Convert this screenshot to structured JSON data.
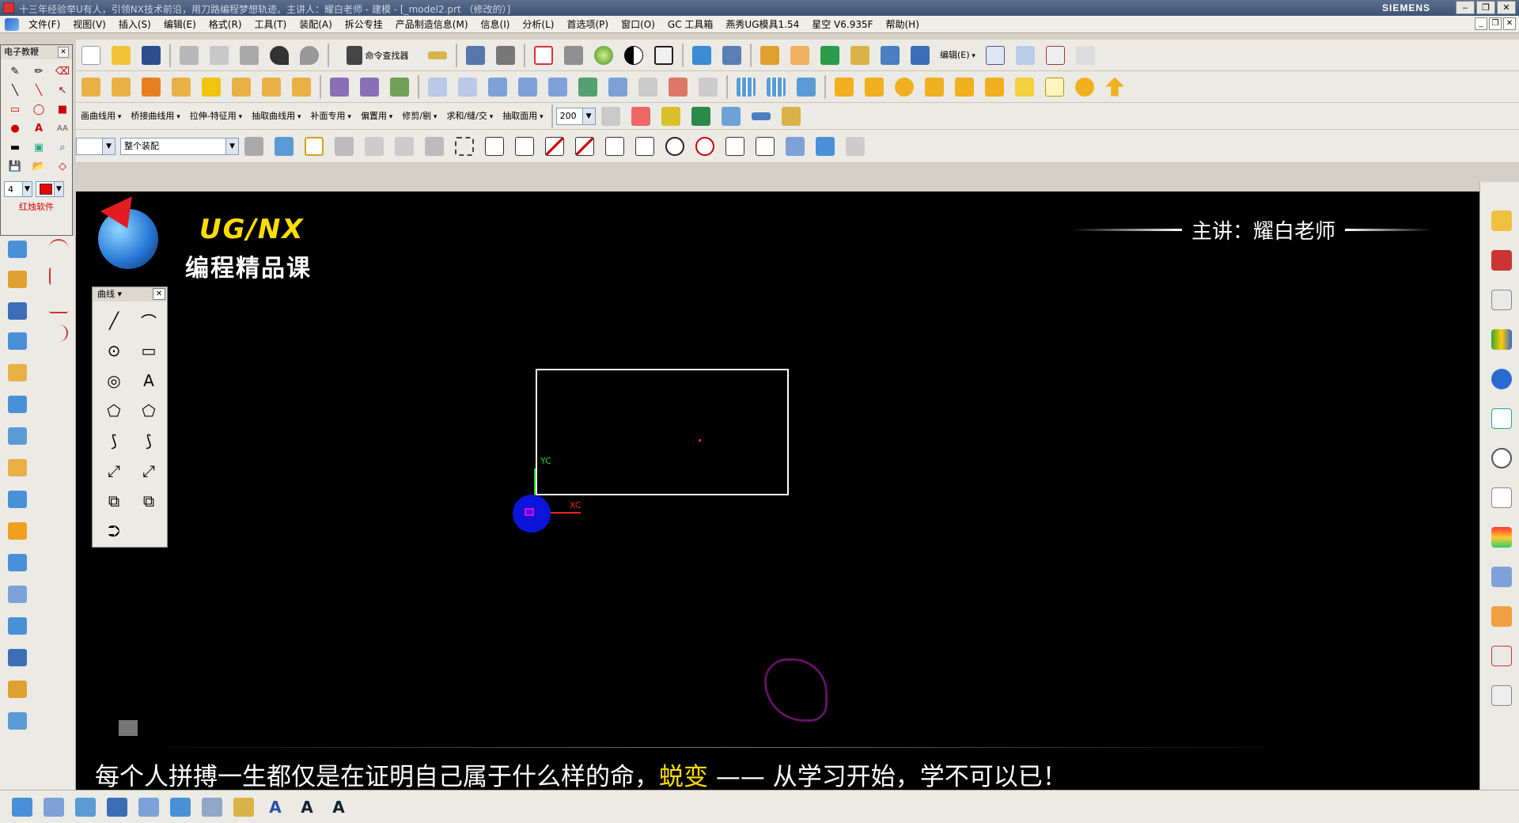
{
  "window": {
    "title": "十三年经验举U有人，引领NX技术前沿，用刀路编程梦想轨迹。主讲人：耀白老师 - 建模 - [_model2.prt （修改的）]",
    "brand": "SIEMENS",
    "buttons": [
      "‒",
      "❐",
      "✕"
    ]
  },
  "menubar": {
    "items": [
      "文件(F)",
      "视图(V)",
      "插入(S)",
      "编辑(E)",
      "格式(R)",
      "工具(T)",
      "装配(A)",
      "拆公专挂",
      "产品制造信息(M)",
      "信息(I)",
      "分析(L)",
      "首选项(P)",
      "窗口(O)",
      "GC 工具箱",
      "燕秀UG模具1.54",
      "星空 V6.935F",
      "帮助(H)"
    ],
    "mdi_buttons": [
      "_",
      "❐",
      "✕"
    ]
  },
  "toolbar1": {
    "command_finder": "命令查找器",
    "edit_label": "编辑(E)"
  },
  "toolbar3": {
    "menus": [
      "画曲线用",
      "桥接曲线用",
      "拉伸-特征用",
      "抽取曲线用",
      "补面专用",
      "偏置用",
      "修剪/剔",
      "求和/缝/交",
      "抽取面用"
    ],
    "zoom_value": "200"
  },
  "toolbar4": {
    "filter_value": "",
    "assembly_scope": "整个装配"
  },
  "palette": {
    "title": "电子教鞭",
    "close": "✕",
    "line_width": "4",
    "footer": "红烛软件",
    "cells": [
      "✎",
      "✏",
      "⌫",
      "╲",
      "╲",
      "↖",
      "▭",
      "◯",
      "■",
      "●",
      "A",
      "AA",
      "▬",
      "▣",
      "⌕",
      "💾",
      "📂",
      "◇"
    ]
  },
  "viewport": {
    "brand_title": "UG/NX",
    "course_title": "编程精品课",
    "lecturer": "主讲：耀白老师",
    "axis_y": "YC",
    "axis_x": "XC",
    "motto_pre": "每个人拼搏一生都仅是在证明自己属于什么样的命，",
    "motto_highlight": "蜕变",
    "motto_post": " —— 从学习开始，学不可以已！"
  },
  "curve_panel": {
    "title": "曲线",
    "close": "✕",
    "tools": [
      "╱",
      "⌒",
      "⊙",
      "▭",
      "◎",
      "A",
      "⬠",
      "⬠",
      "⟆",
      "⟆",
      "⤢",
      "⤢",
      "⧉",
      "⧉",
      "⮊"
    ]
  },
  "colors": {
    "viewport_bg": "#000000",
    "accent_yellow": "#ffdd00",
    "wcs_blue": "#0a15d9",
    "axis_green": "#1ed51e",
    "axis_red": "#ee2222"
  }
}
